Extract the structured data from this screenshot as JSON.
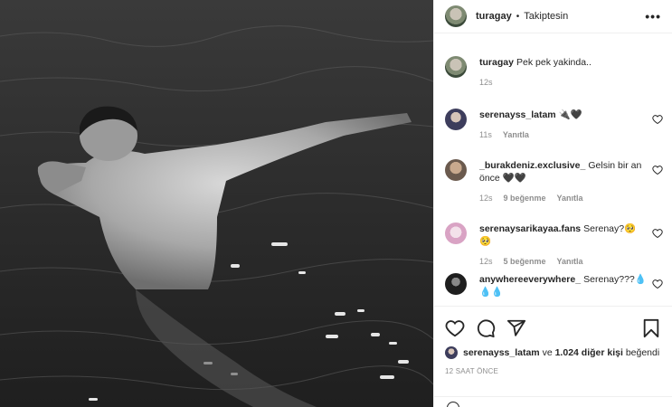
{
  "header": {
    "username": "turagay",
    "separator": "•",
    "follow_status": "Takiptesin",
    "more_icon": "•••"
  },
  "caption": {
    "username": "turagay",
    "text": "Pek pek yakinda..",
    "time": "12s"
  },
  "comments": [
    {
      "username": "serenayss_latam",
      "text": "🔌🖤",
      "time": "11s",
      "likes": "",
      "reply": "Yanıtla",
      "avatar_color": "#3d3d5c"
    },
    {
      "username": "_burakdeniz.exclusive_",
      "text": "Gelsin bir an önce 🖤🖤",
      "time": "12s",
      "likes": "9 beğenme",
      "reply": "Yanıtla",
      "avatar_color": "#6b5a4e"
    },
    {
      "username": "serenaysarikayaa.fans",
      "text": "Serenay?🥺🥺",
      "time": "12s",
      "likes": "5 beğenme",
      "reply": "Yanıtla",
      "avatar_color": "#d9a3c4"
    },
    {
      "username": "anywhereeverywhere_",
      "text": "Serenay???💧💧💧",
      "time": "",
      "likes": "",
      "reply": "",
      "avatar_color": "#1e1e1e"
    }
  ],
  "likes": {
    "first_user": "serenayss_latam",
    "connector": "ve",
    "others": "1.024 diğer kişi",
    "suffix": "beğendi"
  },
  "timestamp": "12 SAAT ÖNCE",
  "icons": {
    "like": "heart-icon",
    "comment": "comment-icon",
    "share": "share-icon",
    "save": "bookmark-icon"
  }
}
